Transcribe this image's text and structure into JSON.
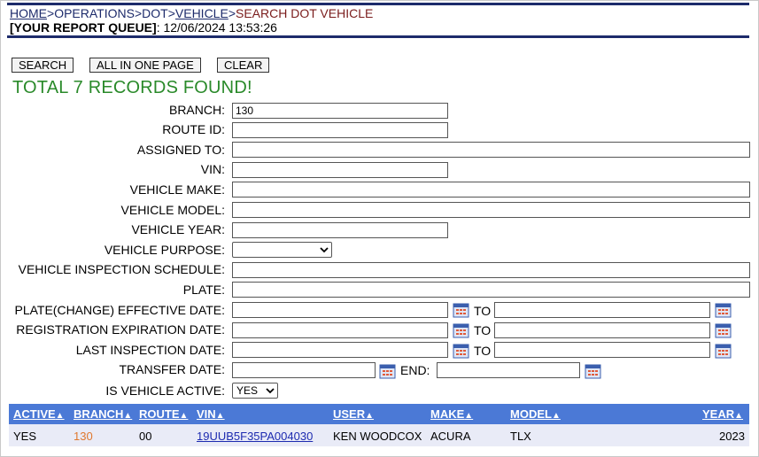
{
  "breadcrumb": {
    "home": "HOME",
    "sep1": ">",
    "operations": "OPERATIONS",
    "sep2": ">",
    "dot": "DOT",
    "sep3": ">",
    "vehicle": "VEHICLE",
    "sep4": ">",
    "current": "SEARCH DOT VEHICLE"
  },
  "report_queue": {
    "label": "[YOUR REPORT QUEUE]",
    "value": ": 12/06/2024 13:53:26"
  },
  "buttons": {
    "search": "SEARCH",
    "all_in_one_page": "ALL IN ONE PAGE",
    "clear": "CLEAR"
  },
  "result_summary": "TOTAL 7 RECORDS FOUND!",
  "form": {
    "branch": {
      "label": "BRANCH:",
      "value": "130"
    },
    "route_id": {
      "label": "ROUTE ID:",
      "value": ""
    },
    "assigned_to": {
      "label": "ASSIGNED TO:",
      "value": ""
    },
    "vin": {
      "label": "VIN:",
      "value": ""
    },
    "vehicle_make": {
      "label": "VEHICLE MAKE:",
      "value": ""
    },
    "vehicle_model": {
      "label": "VEHICLE MODEL:",
      "value": ""
    },
    "vehicle_year": {
      "label": "VEHICLE YEAR:",
      "value": ""
    },
    "vehicle_purpose": {
      "label": "VEHICLE PURPOSE:",
      "value": ""
    },
    "inspection_schedule": {
      "label": "VEHICLE INSPECTION SCHEDULE:",
      "value": ""
    },
    "plate": {
      "label": "PLATE:",
      "value": ""
    },
    "plate_effective_date": {
      "label": "PLATE(CHANGE) EFFECTIVE DATE:",
      "to_label": "TO"
    },
    "registration_expiration_date": {
      "label": "REGISTRATION EXPIRATION DATE:",
      "to_label": "TO"
    },
    "last_inspection_date": {
      "label": "LAST INSPECTION DATE:",
      "to_label": "TO"
    },
    "transfer_date": {
      "label": "TRANSFER DATE:",
      "end_label": "END:"
    },
    "is_vehicle_active": {
      "label": "IS VEHICLE ACTIVE:",
      "value": "YES"
    }
  },
  "table": {
    "headers": {
      "active": "ACTIVE",
      "branch": "BRANCH",
      "route": "ROUTE",
      "vin": "VIN",
      "user": "USER",
      "make": "MAKE",
      "model": "MODEL",
      "year": "YEAR"
    },
    "sort_arrow": "▲",
    "rows": [
      {
        "active": "YES",
        "branch": "130",
        "route": "00",
        "vin": "19UUB5F35PA004030",
        "user": "KEN WOODCOX",
        "make": "ACURA",
        "model": "TLX",
        "year": "2023"
      }
    ]
  },
  "colors": {
    "nav_dark": "#1d2b6b",
    "current_crumb": "#7a1c1c",
    "total_green": "#2a8a2a",
    "table_header": "#4b79d6",
    "table_row": "#e9ebf7",
    "branch_value": "#e0782f"
  }
}
